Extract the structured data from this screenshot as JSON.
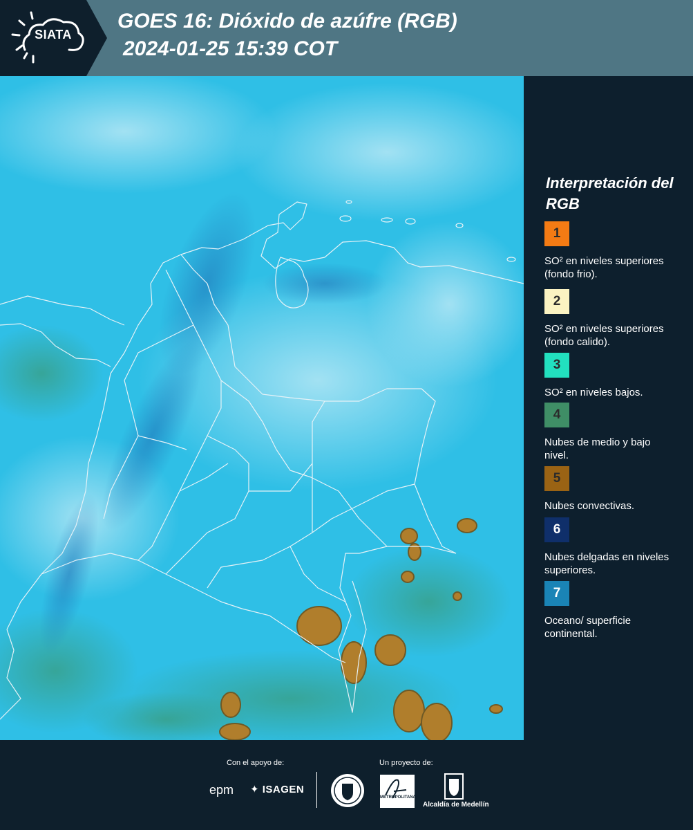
{
  "header": {
    "logo_text": "SIATA",
    "title_line1": "GOES 16: Dióxido de azúfre (RGB)",
    "title_line2": "2024-01-25 15:39 COT"
  },
  "map": {
    "icon": "satellite-image-so2-rgb",
    "base_color": "#2fbfe6",
    "border_color": "#e6f2f7"
  },
  "legend": {
    "title": "Interpretación del RGB",
    "items": [
      {
        "number": "1",
        "color": "#f47b14",
        "label": "SO² en niveles superiores (fondo frio)."
      },
      {
        "number": "2",
        "color": "#fbf3c2",
        "label": "SO² en niveles superiores (fondo calido)."
      },
      {
        "number": "3",
        "color": "#22e0bf",
        "label": "SO² en niveles bajos."
      },
      {
        "number": "4",
        "color": "#3f8e66",
        "label": "Nubes de medio y bajo nivel."
      },
      {
        "number": "5",
        "color": "#9a6314",
        "label": "Nubes convectivas."
      },
      {
        "number": "6",
        "color": "#0f2f6a",
        "label": "Nubes delgadas en niveles superiores."
      },
      {
        "number": "7",
        "color": "#1a84b6",
        "label": "Oceano/ superficie continental."
      }
    ]
  },
  "footer": {
    "support_label": "Con el apoyo de:",
    "project_label": "Un proyecto de:",
    "epm": "epm",
    "isagen": "ISAGEN",
    "area_metropolitana": "METROPOLITANA",
    "alcaldia": "Alcaldía de Medellín"
  }
}
